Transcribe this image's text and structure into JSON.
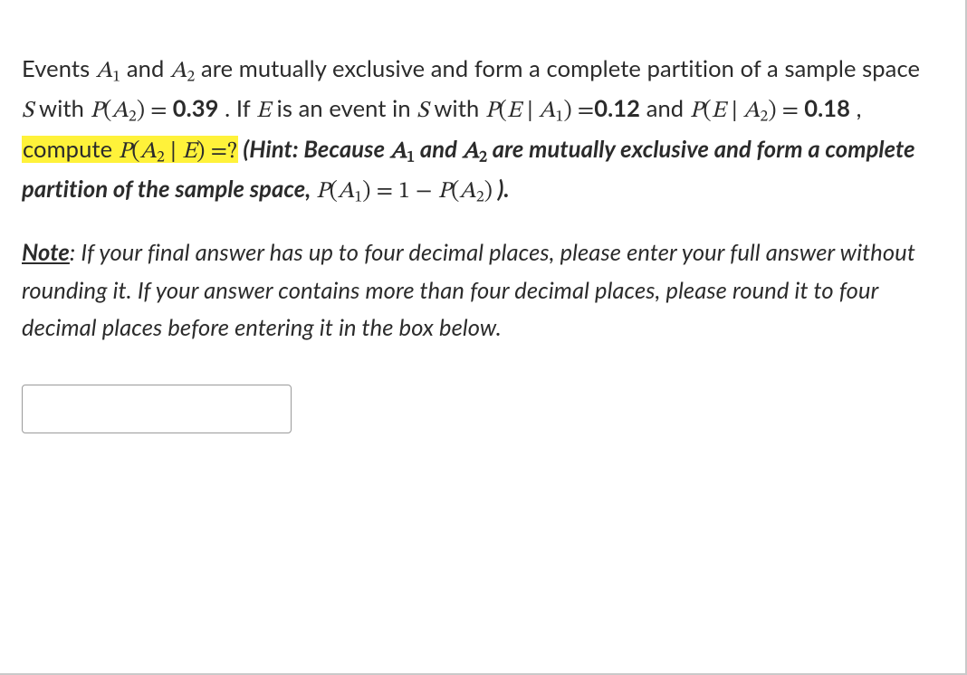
{
  "q": {
    "t1a": "Events ",
    "A1": "A",
    "sub1": "1",
    "t1b": " and ",
    "A2": "A",
    "sub2": "2",
    "t1c": " are mutually exclusive and form a complete partition of a sample space ",
    "S": "S",
    "t2": " with ",
    "PA2_lhs_P": "P",
    "PA2_lhs_open": "(",
    "PA2_lhs_A": "A",
    "PA2_lhs_sub": "2",
    "PA2_lhs_close": ")",
    "eq1": " = ",
    "PA2_val": "0.39",
    "t3": " .  If ",
    "E": "E",
    "t4": " is an event in ",
    "t5": " with ",
    "PEA1_P": "P",
    "PEA1_open": "(",
    "PEA1_E": "E",
    "PEA1_bar": " ∣ ",
    "PEA1_A": "A",
    "PEA1_sub": "1",
    "PEA1_close": ")",
    "eq2": " =",
    "PEA1_val": "0.12",
    "t6": "  and   ",
    "PEA2_P": "P",
    "PEA2_open": "(",
    "PEA2_E": "E",
    "PEA2_bar": " ∣ ",
    "PEA2_A": "A",
    "PEA2_sub": "2",
    "PEA2_close": ")",
    "eq3": " = ",
    "PEA2_val": "0.18",
    "t7": " , ",
    "hl_pre": "compute ",
    "hl_P": "P",
    "hl_open": "(",
    "hl_A": "A",
    "hl_sub": "2",
    "hl_bar": " ∣ ",
    "hl_E": "E",
    "hl_close": ")",
    "hl_eq": " =",
    "hl_q": "?",
    "hint1": "  (Hint: Because  ",
    "hint2": " and ",
    "hint3": " are mutually exclusive and form a complete partition of the sample space, ",
    "hint_eq_P1": "P",
    "hint_eq_open1": "(",
    "hint_eq_A1": "A",
    "hint_eq_sub1": "1",
    "hint_eq_close1": ")",
    "hint_eq_eq": " = ",
    "hint_eq_one": "1",
    "hint_eq_minus": " − ",
    "hint_eq_P2": "P",
    "hint_eq_open2": "(",
    "hint_eq_A2": "A",
    "hint_eq_sub2": "2",
    "hint_eq_close2": ")",
    "hint_end": " )."
  },
  "note": {
    "label": "Note",
    "colon": ": ",
    "body": "If your final answer has up to four decimal places, please enter your full answer without rounding it. If your answer contains more than four decimal places, please round it to four decimal places before entering it in the box below."
  },
  "answer_value": ""
}
